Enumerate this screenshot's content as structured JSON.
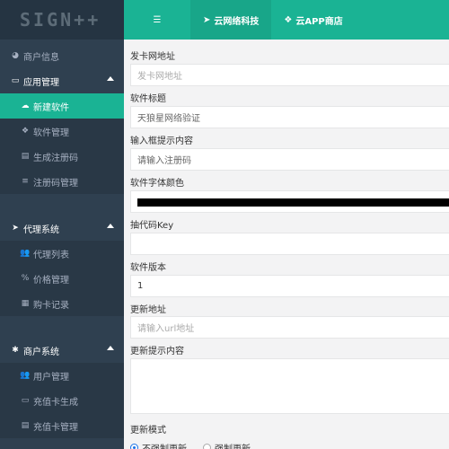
{
  "logo": {
    "text": "SIGN++"
  },
  "header": {
    "menu_icon": "list-icon",
    "tabs": [
      {
        "label": "云网络科技",
        "icon": "paper-plane-icon",
        "active": true
      },
      {
        "label": "云APP商店",
        "icon": "dropbox-icon",
        "active": false
      }
    ]
  },
  "sidebar": {
    "top_item": {
      "label": "商户信息",
      "icon": "dashboard-icon"
    },
    "groups": [
      {
        "title": "应用管理",
        "icon": "window-icon",
        "items": [
          {
            "label": "新建软件",
            "icon": "cloud-icon",
            "active": true
          },
          {
            "label": "软件管理",
            "icon": "cubes-icon"
          },
          {
            "label": "生成注册码",
            "icon": "keyboard-icon"
          },
          {
            "label": "注册码管理",
            "icon": "list-icon"
          }
        ]
      },
      {
        "title": "代理系统",
        "icon": "paper-plane-icon",
        "items": [
          {
            "label": "代理列表",
            "icon": "users-icon"
          },
          {
            "label": "价格管理",
            "icon": "percent-icon"
          },
          {
            "label": "购卡记录",
            "icon": "calculator-icon"
          }
        ]
      },
      {
        "title": "商户系统",
        "icon": "bug-icon",
        "items": [
          {
            "label": "用户管理",
            "icon": "users-icon"
          },
          {
            "label": "充值卡生成",
            "icon": "credit-card-icon"
          },
          {
            "label": "充值卡管理",
            "icon": "keyboard-icon"
          }
        ]
      }
    ]
  },
  "form": {
    "card_url": {
      "label": "发卡网地址",
      "placeholder": "发卡网地址"
    },
    "software_title": {
      "label": "软件标题",
      "value": "天狼星网络验证"
    },
    "input_hint": {
      "label": "输入框提示内容",
      "value": "请输入注册码"
    },
    "font_color": {
      "label": "软件字体颜色",
      "value": "#000000"
    },
    "lottery_key": {
      "label": "抽代码Key",
      "value": ""
    },
    "version": {
      "label": "软件版本",
      "value": "1"
    },
    "update_url": {
      "label": "更新地址",
      "placeholder": "请输入url地址"
    },
    "update_hint": {
      "label": "更新提示内容",
      "value": ""
    },
    "update_mode": {
      "label": "更新模式",
      "options": [
        {
          "label": "不强制更新",
          "checked": true
        },
        {
          "label": "强制更新",
          "checked": false
        }
      ]
    }
  }
}
